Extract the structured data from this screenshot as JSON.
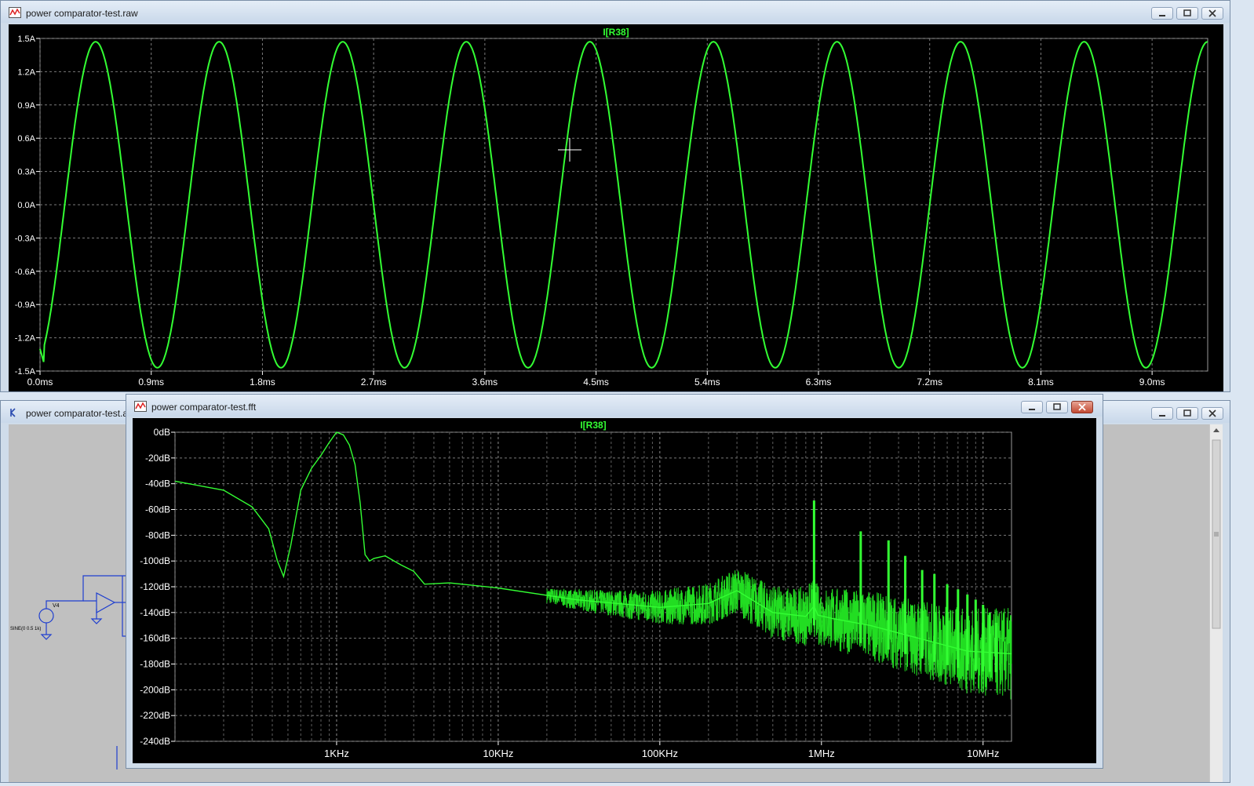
{
  "colors": {
    "trace": "#33ff33",
    "grid": "#7a7a7a",
    "plot_bg": "#000000",
    "axis_text": "#ffffff",
    "schematic_wire": "#1f3fcf"
  },
  "raw_window": {
    "title": "power comparator-test.raw",
    "icon": "waveform-window-icon",
    "trace_label": "I[R38]"
  },
  "schematic_window": {
    "title": "power comparator-test.a",
    "icon": "schematic-window-icon",
    "component_label": "V4",
    "source_label": "SINE(0 0.5 1k)"
  },
  "fft_window": {
    "title": "power comparator-test.fft",
    "icon": "waveform-window-icon",
    "trace_label": "I[R38]"
  },
  "chart_data": [
    {
      "type": "line",
      "title": "I[R38]",
      "x_unit": "ms",
      "y_unit": "A",
      "xlim": [
        0,
        9.45
      ],
      "ylim": [
        -1.5,
        1.5
      ],
      "x_ticks": [
        "0.0ms",
        "0.9ms",
        "1.8ms",
        "2.7ms",
        "3.6ms",
        "4.5ms",
        "5.4ms",
        "6.3ms",
        "7.2ms",
        "8.1ms",
        "9.0ms"
      ],
      "y_ticks": [
        "1.5A",
        "1.2A",
        "0.9A",
        "0.6A",
        "0.3A",
        "0.0A",
        "-0.3A",
        "-0.6A",
        "-0.9A",
        "-1.2A",
        "-1.5A"
      ],
      "grid": true,
      "series": [
        {
          "name": "I[R38]",
          "waveform": "sine",
          "amplitude": 1.47,
          "period_ms": 1.0,
          "peak_times_ms": [
            0.45,
            1.45,
            2.45,
            3.45,
            4.45,
            5.45,
            6.45,
            7.45,
            8.45
          ],
          "trough_times_ms": [
            0.95,
            1.95,
            2.95,
            3.95,
            4.95,
            5.95,
            6.95,
            7.95,
            8.95
          ]
        }
      ]
    },
    {
      "type": "line",
      "title": "I[R38]",
      "x_scale": "log",
      "x_unit": "Hz",
      "y_unit": "dB",
      "xlim": [
        100,
        15000000
      ],
      "ylim": [
        -240,
        0
      ],
      "x_ticks": [
        "1KHz",
        "10KHz",
        "100KHz",
        "1MHz",
        "10MHz"
      ],
      "y_ticks": [
        "0dB",
        "-20dB",
        "-40dB",
        "-60dB",
        "-80dB",
        "-100dB",
        "-120dB",
        "-140dB",
        "-160dB",
        "-180dB",
        "-200dB",
        "-220dB",
        "-240dB"
      ],
      "grid": true,
      "series": [
        {
          "name": "I[R38]",
          "x": [
            100,
            200,
            300,
            380,
            430,
            470,
            520,
            600,
            700,
            800,
            900,
            1000,
            1100,
            1200,
            1300,
            1400,
            1500,
            1600,
            1700,
            2000,
            2500,
            3000,
            3500,
            5000,
            10000,
            30000,
            100000,
            200000,
            300000,
            500000,
            800000,
            900000,
            950000,
            1200000,
            2000000,
            4000000,
            8000000,
            15000000
          ],
          "y": [
            -38,
            -45,
            -58,
            -75,
            -100,
            -112,
            -88,
            -45,
            -28,
            -18,
            -8,
            0,
            -2,
            -10,
            -25,
            -55,
            -95,
            -100,
            -98,
            -96,
            -103,
            -108,
            -118,
            -117,
            -121,
            -130,
            -136,
            -133,
            -123,
            -140,
            -143,
            -135,
            -142,
            -145,
            -150,
            -160,
            -170,
            -172
          ]
        },
        {
          "name": "harmonic spikes",
          "x": [
            900000,
            1750000,
            2600000,
            3300000,
            4200000,
            5000000,
            6000000,
            7000000,
            8000000,
            9000000,
            10000000,
            11000000,
            12000000
          ],
          "y": [
            -53,
            -77,
            -84,
            -96,
            -107,
            -110,
            -118,
            -122,
            -126,
            -130,
            -134,
            -140,
            -148
          ]
        }
      ]
    }
  ]
}
